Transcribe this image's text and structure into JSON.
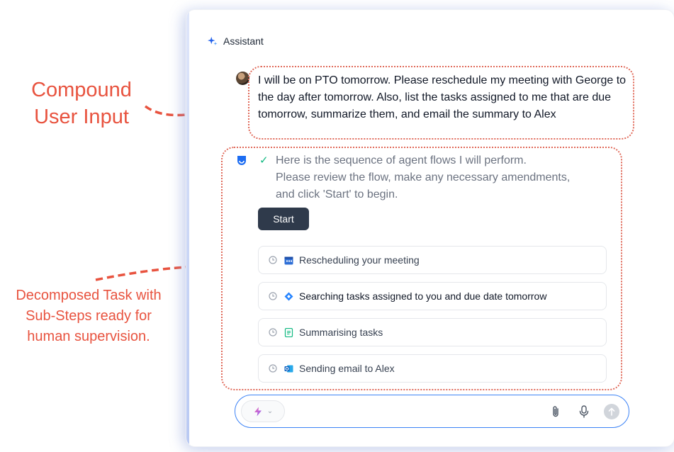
{
  "annotations": {
    "compound": [
      "Compound",
      "User Input"
    ],
    "decomposed": [
      "Decomposed Task with",
      "Sub-Steps ready for",
      "human supervision."
    ]
  },
  "panel": {
    "header_title": "Assistant",
    "header_icon": "sparkle-icon"
  },
  "user_message": {
    "text": "I will be on PTO tomorrow. Please reschedule my meeting with George to the day after tomorrow. Also, list the tasks assigned to me that are due tomorrow, summarize them, and email the summary to Alex"
  },
  "assistant_message": {
    "lines": [
      "Here is the sequence of agent flows I will perform.",
      "Please review the flow, make any necessary amendments,",
      "and click 'Start' to begin."
    ],
    "start_label": "Start"
  },
  "steps": [
    {
      "label": "Rescheduling your meeting",
      "icon": "calendar-icon"
    },
    {
      "label": "Searching tasks assigned to you and due date tomorrow",
      "icon": "jira-icon"
    },
    {
      "label": "Summarising tasks",
      "icon": "document-icon"
    },
    {
      "label": "Sending email to Alex",
      "icon": "outlook-icon"
    }
  ],
  "input": {
    "placeholder": "",
    "mode_icon": "lightning-icon"
  },
  "colors": {
    "annotation": "#e8533f",
    "start_button": "#2f3a4b",
    "input_border": "#3b82f6",
    "check": "#10b981"
  }
}
